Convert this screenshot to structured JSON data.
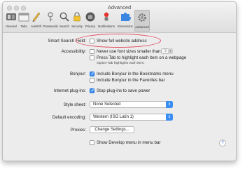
{
  "window": {
    "title": "Advanced"
  },
  "toolbar": {
    "items": [
      {
        "label": "General",
        "icon": "general-switch-icon"
      },
      {
        "label": "Tabs",
        "icon": "tabs-icon"
      },
      {
        "label": "AutoFill",
        "icon": "pencil-icon"
      },
      {
        "label": "Passwords",
        "icon": "key-icon"
      },
      {
        "label": "Search",
        "icon": "magnifier-icon"
      },
      {
        "label": "Security",
        "icon": "padlock-icon"
      },
      {
        "label": "Privacy",
        "icon": "hand-icon"
      },
      {
        "label": "Notifications",
        "icon": "bell-icon"
      },
      {
        "label": "Extensions",
        "icon": "puzzle-icon"
      },
      {
        "label": "Advanced",
        "icon": "gear-icon"
      }
    ],
    "active": "Advanced"
  },
  "settings": {
    "smart_search_label": "Smart Search Field:",
    "smart_search_option": "Show full website address",
    "accessibility_label": "Accessibility:",
    "font_size_option": "Never use font sizes smaller than",
    "font_size_value": "9",
    "tab_option": "Press Tab to highlight each item on a webpage",
    "tab_note": "Option-Tab highlights each item.",
    "bonjour_label": "Bonjour:",
    "bonjour_bookmarks": "Include Bonjour in the Bookmarks menu",
    "bonjour_favorites": "Include Bonjour in the Favorites bar",
    "plugins_label": "Internet plug-ins:",
    "plugins_option": "Stop plug-ins to save power",
    "stylesheet_label": "Style sheet:",
    "stylesheet_value": "None Selected",
    "encoding_label": "Default encoding:",
    "encoding_value": "Western (ISO Latin 1)",
    "proxies_label": "Proxies:",
    "proxies_button": "Change Settings...",
    "develop_option": "Show Develop menu in menu bar",
    "help": "?"
  },
  "colors": {
    "accent": "#3b8ef2",
    "highlight": "#e0485b"
  }
}
